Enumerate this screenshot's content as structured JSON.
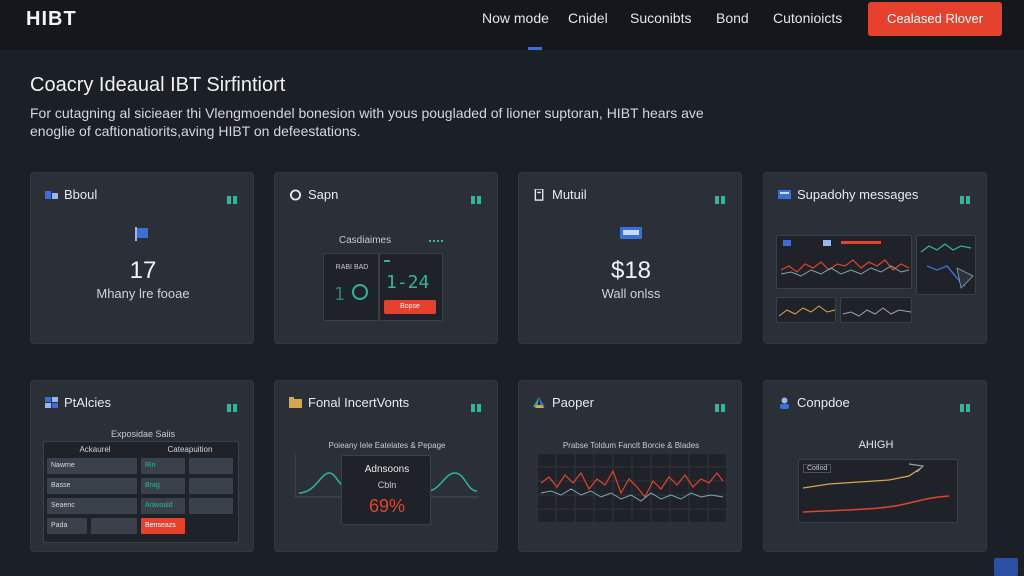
{
  "header": {
    "logo": "HIBT",
    "nav": [
      "Now mode",
      "Cnidel",
      "Suconibts",
      "Bond",
      "Cutonioicts"
    ],
    "cta": "Cealased Rlover"
  },
  "page": {
    "title": "Coacry Ideaual IBT Sirfintiort",
    "description": "For cutagning al sicieaer thi Vlengmoendel bonesion with yous pougladed of lioner suptoran, HIBT hears ave enoglie of caftionatiorits,aving HIBT on defeestations."
  },
  "cards": {
    "c1": {
      "title": "Bboul",
      "value": "17",
      "label": "Mhany lre fooae"
    },
    "c2": {
      "title": "Sapn",
      "caption": "Casdiaimes",
      "left_label": "RABI BAD",
      "right_value": "1-24",
      "button": "Bopse"
    },
    "c3": {
      "title": "Mutuil",
      "value": "$18",
      "label": "Wall onlss"
    },
    "c4": {
      "title": "Supadohy messages"
    },
    "c5": {
      "title": "PtAlcies",
      "caption": "Exposidae Saiis",
      "headers": [
        "Ackaurel",
        "Cateapuition"
      ],
      "rows": [
        [
          "Nawme",
          "Rin",
          ""
        ],
        [
          "Basse",
          "Brag",
          ""
        ],
        [
          "Seaenc",
          "Aravoald",
          ""
        ],
        [
          "Pada",
          "",
          "Benseazs"
        ]
      ]
    },
    "c6": {
      "title": "Fonal IncertVonts",
      "caption": "Poieany Iele Eatelates & Pepage",
      "overlay_title": "Adnsoons",
      "overlay_sub": "Cbln",
      "percent": "69%"
    },
    "c7": {
      "title": "Paoper",
      "caption": "Prabse Toldum Fanclt Borcie & Blades"
    },
    "c8": {
      "title": "Conpdoe",
      "caption": "AHIGH",
      "legend": "Cotlod"
    }
  },
  "colors": {
    "accent": "#e5412d",
    "teal": "#2fb59a",
    "blue": "#3a6fd8",
    "card": "#2b3038"
  }
}
